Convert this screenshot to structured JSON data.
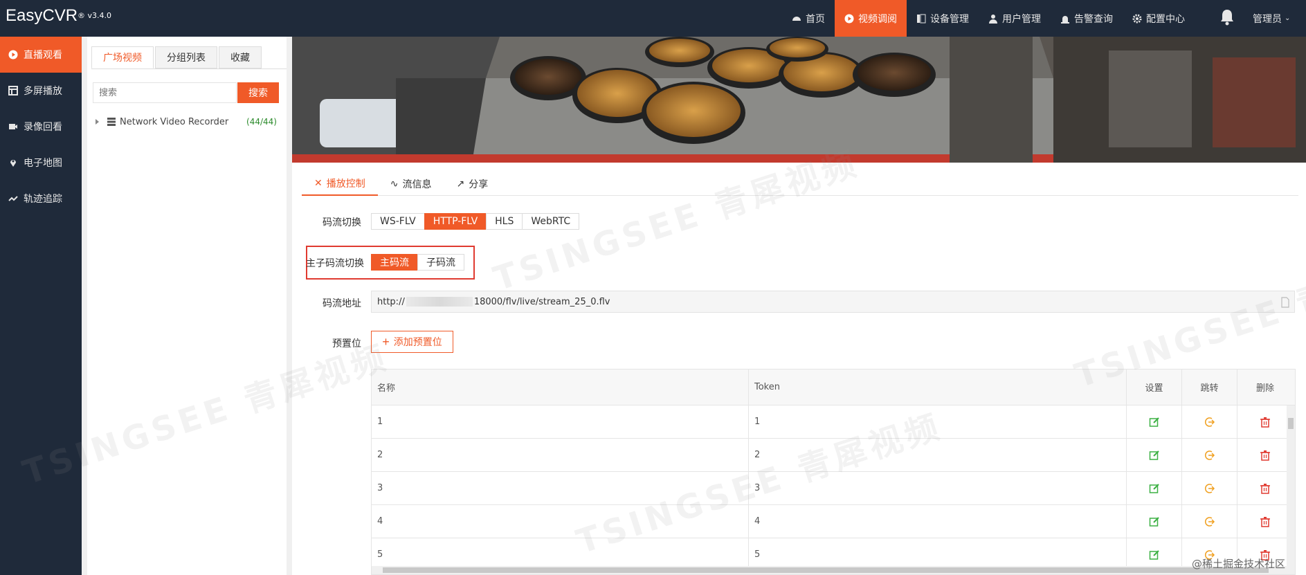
{
  "app": {
    "title": "EasyCVR",
    "version": "® v3.4.0"
  },
  "topnav": [
    {
      "label": "首页",
      "icon": "dashboard-icon",
      "active": false
    },
    {
      "label": "视频调阅",
      "icon": "play-circle-icon",
      "active": true
    },
    {
      "label": "设备管理",
      "icon": "device-icon",
      "active": false
    },
    {
      "label": "用户管理",
      "icon": "user-icon",
      "active": false
    },
    {
      "label": "告警查询",
      "icon": "alarm-icon",
      "active": false
    },
    {
      "label": "配置中心",
      "icon": "gear-icon",
      "active": false
    }
  ],
  "user": {
    "label": "管理员"
  },
  "sidebar": [
    {
      "label": "直播观看",
      "icon": "play-circle-icon",
      "active": true
    },
    {
      "label": "多屏播放",
      "icon": "grid-icon",
      "active": false
    },
    {
      "label": "录像回看",
      "icon": "camera-icon",
      "active": false
    },
    {
      "label": "电子地图",
      "icon": "map-pin-icon",
      "active": false
    },
    {
      "label": "轨迹追踪",
      "icon": "track-icon",
      "active": false
    }
  ],
  "leftpanel": {
    "tabs": [
      "广场视频",
      "分组列表",
      "收藏"
    ],
    "search_placeholder": "搜索",
    "search_button": "搜索",
    "tree": [
      {
        "label": "Network Video Recorder",
        "count": "(44/44)"
      }
    ]
  },
  "controls": {
    "tabs": [
      {
        "label": "播放控制",
        "icon": "tools-icon",
        "active": true
      },
      {
        "label": "流信息",
        "icon": "pulse-icon",
        "active": false
      },
      {
        "label": "分享",
        "icon": "share-icon",
        "active": false
      }
    ],
    "stream_switch_label": "码流切换",
    "stream_options": [
      "WS-FLV",
      "HTTP-FLV",
      "HLS",
      "WebRTC"
    ],
    "stream_selected": "HTTP-FLV",
    "substream_label": "主子码流切换",
    "substream_options": [
      "主码流",
      "子码流"
    ],
    "substream_selected": "主码流",
    "url_label": "码流地址",
    "url_prefix": "http://",
    "url_suffix": "18000/flv/live/stream_25_0.flv",
    "preset_label": "预置位",
    "add_preset": "添加预置位"
  },
  "presets": {
    "headers": [
      "名称",
      "Token",
      "设置",
      "跳转",
      "删除"
    ],
    "rows": [
      {
        "name": "1",
        "token": "1"
      },
      {
        "name": "2",
        "token": "2"
      },
      {
        "name": "3",
        "token": "3"
      },
      {
        "name": "4",
        "token": "4"
      },
      {
        "name": "5",
        "token": "5"
      }
    ]
  },
  "credit": "@稀土掘金技术社区",
  "watermark": "TSINGSEE 青犀视频",
  "colors": {
    "accent": "#f05a28",
    "nav_bg": "#1f2a3a",
    "edit": "#3cb043",
    "jump": "#f0a020",
    "delete": "#e03a30"
  }
}
